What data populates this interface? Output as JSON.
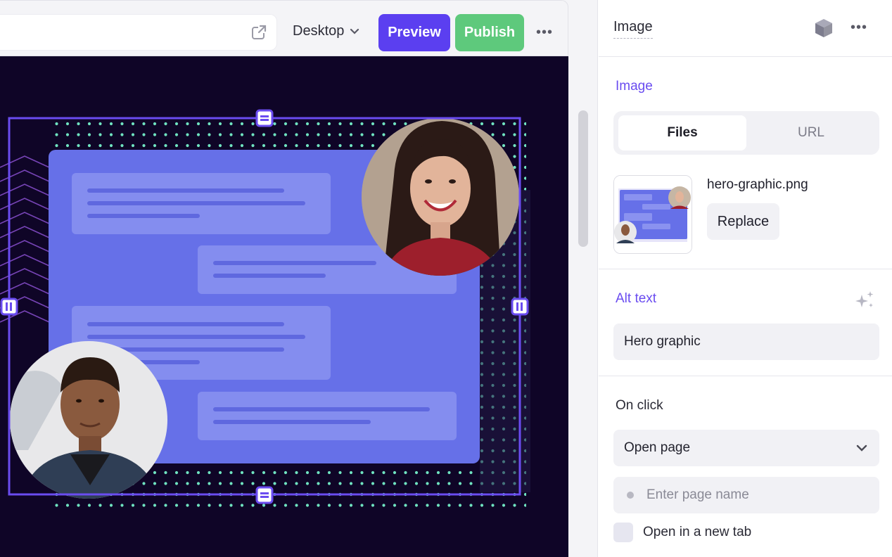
{
  "toolbar": {
    "device": "Desktop",
    "preview_label": "Preview",
    "publish_label": "Publish",
    "more": "•••"
  },
  "panel": {
    "title": "Image",
    "more": "•••",
    "image_section": {
      "label": "Image",
      "tabs": [
        {
          "label": "Files",
          "active": true
        },
        {
          "label": "URL",
          "active": false
        }
      ],
      "filename": "hero-graphic.png",
      "replace_label": "Replace"
    },
    "alt_section": {
      "label": "Alt text",
      "value": "Hero graphic"
    },
    "click_section": {
      "label": "On click",
      "action": "Open page",
      "page_placeholder": "Enter page name",
      "new_tab_label": "Open in a new tab",
      "new_tab_checked": false
    }
  },
  "colors": {
    "accent": "#5b3ff0",
    "publish": "#5ec97c",
    "canvas_bg": "#0f0527",
    "card": "#6670e8",
    "dots": "#6fe3c0"
  },
  "icons": [
    "external-link-icon",
    "chevron-down-icon",
    "more-icon",
    "cube-icon",
    "sparkle-icon",
    "dot-icon"
  ]
}
